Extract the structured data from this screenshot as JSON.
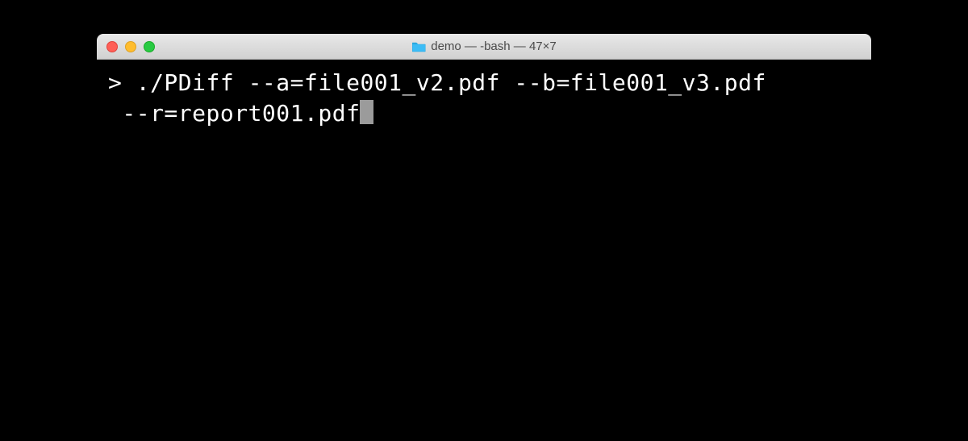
{
  "window": {
    "title": "demo — -bash — 47×7"
  },
  "terminal": {
    "prompt": "> ",
    "command_line1": "./PDiff --a=file001_v2.pdf --b=file001_v3.pdf",
    "command_line2": " --r=report001.pdf"
  }
}
